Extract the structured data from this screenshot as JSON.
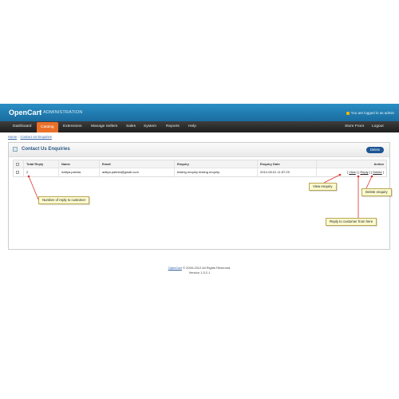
{
  "header": {
    "logo": "OpenCart",
    "section": "| ADMINISTRATION",
    "logged_in": "You are logged in as admin"
  },
  "menu": {
    "items": [
      "Dashboard",
      "Catalog",
      "Extensions",
      "Manage Sellers",
      "Sales",
      "System",
      "Reports",
      "Help"
    ],
    "right": [
      "Store Front",
      "Logout"
    ],
    "active": "Catalog"
  },
  "breadcrumb": [
    "Home",
    "::",
    "Contact Us Enquiries"
  ],
  "panel": {
    "title": "Contact Us Enquiries",
    "delete_label": "Delete"
  },
  "table": {
    "columns": [
      "",
      "Total Reply",
      "Name",
      "Email",
      "Enquiry",
      "Enquiry Date",
      "Action"
    ],
    "rows": [
      {
        "total_reply": "2",
        "name": "Aditya.palmia",
        "email": "aditya.palmia@gmail.com",
        "enquiry": "testing enquiry testing enquiry",
        "date": "2012-05-01 11:57:29",
        "actions": [
          "View",
          "Reply",
          "Delete"
        ]
      }
    ]
  },
  "annotations": {
    "reply_count": "Number of reply to customer",
    "view": "View enquiry",
    "delete": "Delete enquiry",
    "reply": "Reply to customer from here",
    "arrow_color": "#e03030"
  },
  "footer": {
    "link": "OpenCart",
    "copyright": "© 2009-2012 All Rights Reserved.",
    "version": "Version 1.5.2.1"
  }
}
